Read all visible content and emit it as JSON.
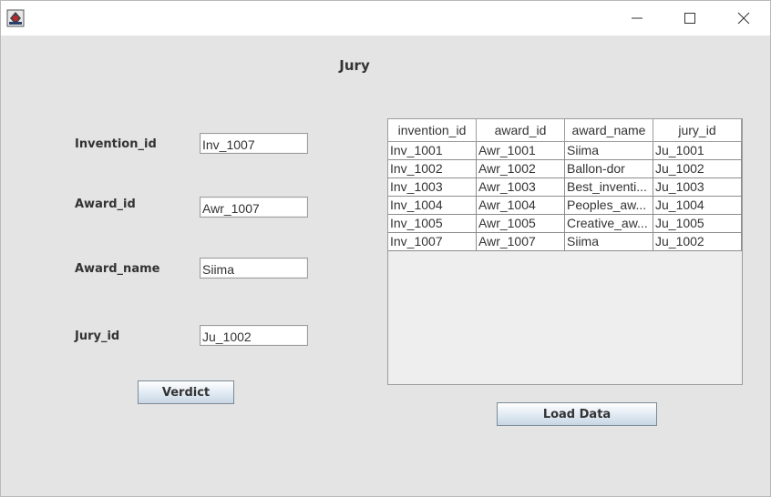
{
  "window": {
    "controls": {
      "minimize": "minimize-icon",
      "maximize": "maximize-icon",
      "close": "close-icon"
    }
  },
  "form": {
    "heading": "Jury",
    "invention_id": {
      "label": "Invention_id",
      "value": "Inv_1007"
    },
    "award_id": {
      "label": "Award_id",
      "value": "Awr_1007"
    },
    "award_name": {
      "label": "Award_name",
      "value": "Siima"
    },
    "jury_id": {
      "label": "Jury_id",
      "value": "Ju_1002"
    },
    "verdict_label": "Verdict"
  },
  "table": {
    "columns": [
      "invention_id",
      "award_id",
      "award_name",
      "jury_id"
    ],
    "rows": [
      [
        "Inv_1001",
        "Awr_1001",
        "Siima",
        "Ju_1001"
      ],
      [
        "Inv_1002",
        "Awr_1002",
        "Ballon-dor",
        "Ju_1002"
      ],
      [
        "Inv_1003",
        "Awr_1003",
        "Best_inventi...",
        "Ju_1003"
      ],
      [
        "Inv_1004",
        "Awr_1004",
        "Peoples_aw...",
        "Ju_1004"
      ],
      [
        "Inv_1005",
        "Awr_1005",
        "Creative_aw...",
        "Ju_1005"
      ],
      [
        "Inv_1007",
        "Awr_1007",
        "Siima",
        "Ju_1002"
      ]
    ],
    "load_label": "Load Data"
  }
}
